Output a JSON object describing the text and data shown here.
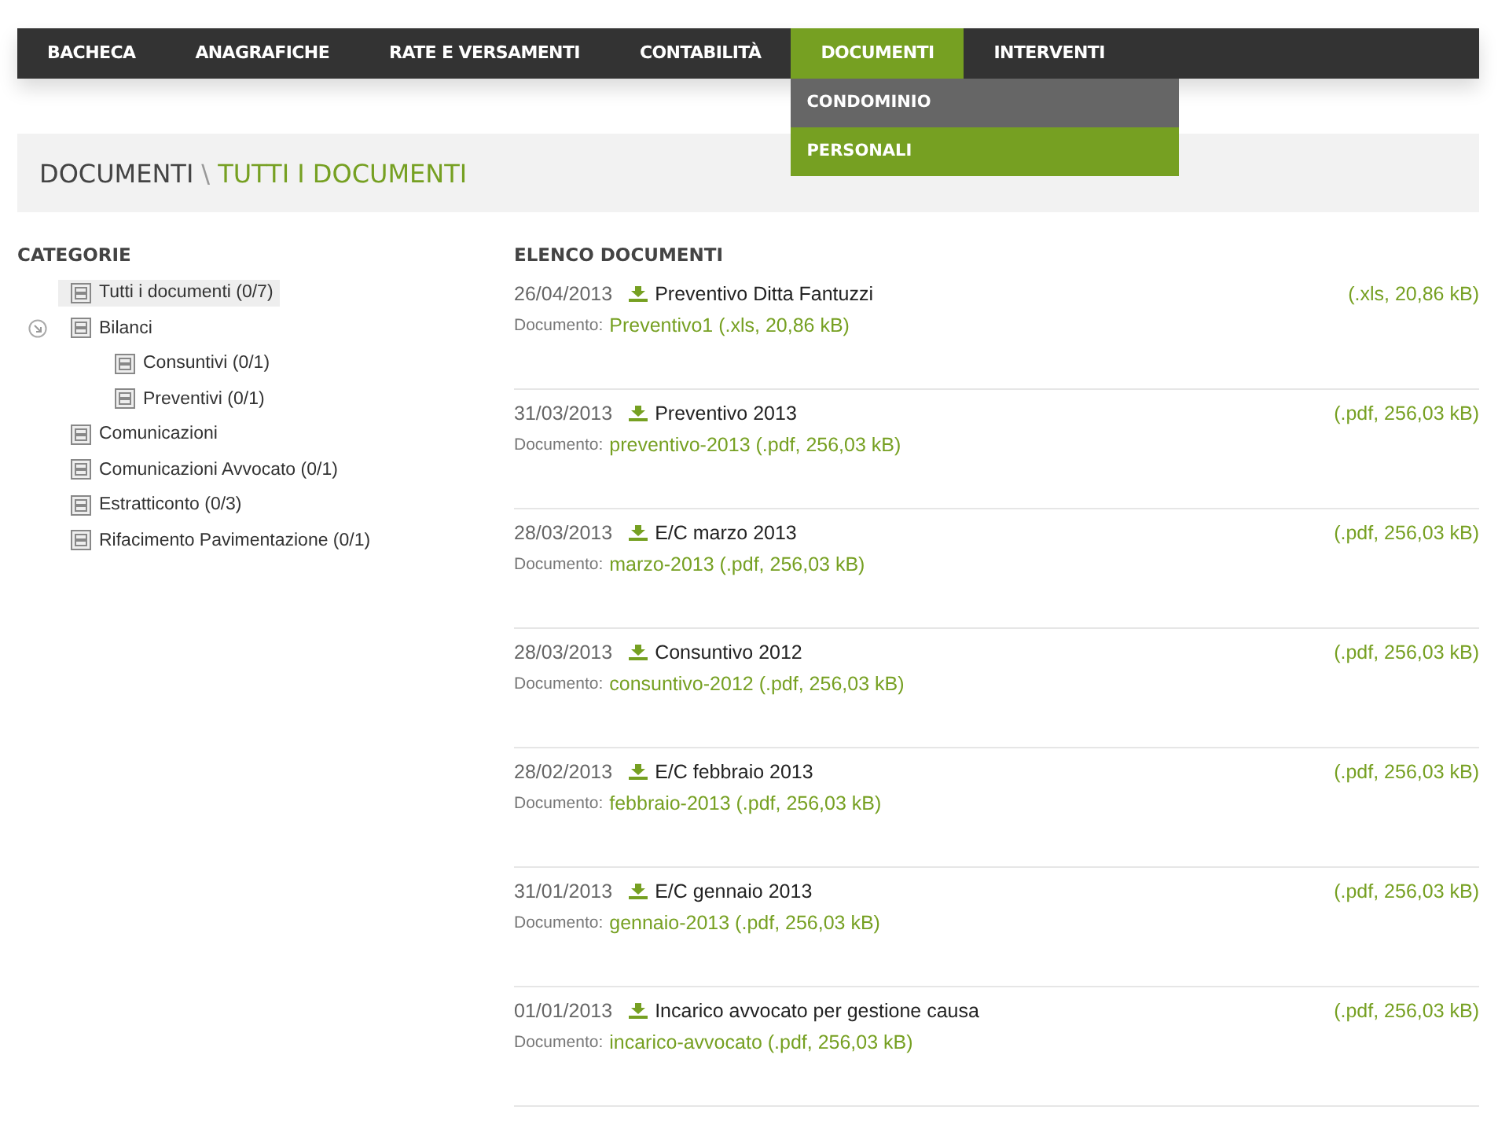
{
  "nav": [
    {
      "label": "BACHECA",
      "selected": false
    },
    {
      "label": "ANAGRAFICHE",
      "selected": false
    },
    {
      "label": "RATE E VERSAMENTI",
      "selected": false
    },
    {
      "label": "CONTABILITÀ",
      "selected": false
    },
    {
      "label": "DOCUMENTI",
      "selected": true,
      "submenu": [
        {
          "label": "CONDOMINIO",
          "selected": false
        },
        {
          "label": "PERSONALI",
          "selected": true
        }
      ]
    },
    {
      "label": "INTERVENTI",
      "selected": false
    }
  ],
  "breadcrumb": {
    "section": "DOCUMENTI",
    "separator": "\\",
    "page": "TUTTI I DOCUMENTI"
  },
  "categories": {
    "title": "CATEGORIE",
    "items": [
      {
        "label": "Tutti i documenti (0/7)",
        "selected": true
      },
      {
        "label": "Bilanci",
        "selected": false,
        "expanded": true,
        "children": [
          {
            "label": "Consuntivi (0/1)",
            "selected": false
          },
          {
            "label": "Preventivi (0/1)",
            "selected": false
          }
        ]
      },
      {
        "label": "Comunicazioni",
        "selected": false
      },
      {
        "label": "Comunicazioni Avvocato (0/1)",
        "selected": false
      },
      {
        "label": "Estratticonto (0/3)",
        "selected": false
      },
      {
        "label": "Rifacimento Pavimentazione (0/1)",
        "selected": false
      }
    ]
  },
  "documents": {
    "title": "ELENCO DOCUMENTI",
    "items": [
      {
        "date": "26/04/2013",
        "title": "Preventivo Ditta Fantuzzi",
        "size": "(.xls, 20,86 kB)",
        "file_label": "Documento:",
        "file": "Preventivo1 (.xls, 20,86 kB)"
      },
      {
        "date": "31/03/2013",
        "title": "Preventivo 2013",
        "size": "(.pdf, 256,03 kB)",
        "file_label": "Documento:",
        "file": "preventivo-2013 (.pdf, 256,03 kB)"
      },
      {
        "date": "28/03/2013",
        "title": "E/C marzo 2013",
        "size": "(.pdf, 256,03 kB)",
        "file_label": "Documento:",
        "file": "marzo-2013 (.pdf, 256,03 kB)"
      },
      {
        "date": "28/03/2013",
        "title": "Consuntivo 2012",
        "size": "(.pdf, 256,03 kB)",
        "file_label": "Documento:",
        "file": "consuntivo-2012 (.pdf, 256,03 kB)"
      },
      {
        "date": "28/02/2013",
        "title": "E/C febbraio 2013",
        "size": "(.pdf, 256,03 kB)",
        "file_label": "Documento:",
        "file": "febbraio-2013 (.pdf, 256,03 kB)"
      },
      {
        "date": "31/01/2013",
        "title": "E/C gennaio 2013",
        "size": "(.pdf, 256,03 kB)",
        "file_label": "Documento:",
        "file": "gennaio-2013 (.pdf, 256,03 kB)"
      },
      {
        "date": "01/01/2013",
        "title": "Incarico avvocato per gestione causa",
        "size": "(.pdf, 256,03 kB)",
        "file_label": "Documento:",
        "file": "incarico-avvocato (.pdf, 256,03 kB)"
      }
    ]
  }
}
